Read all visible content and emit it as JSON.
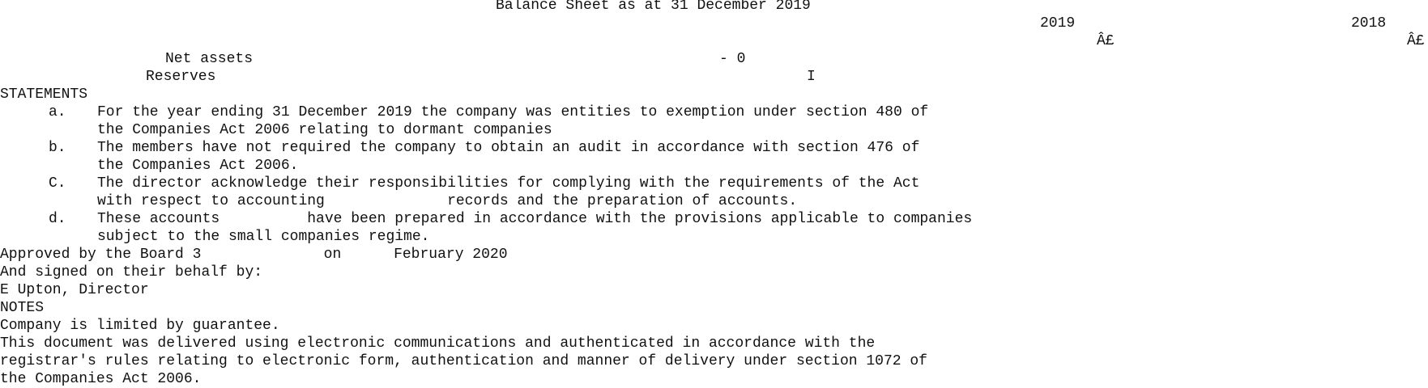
{
  "title": "Balance Sheet as at 31 December 2019",
  "columns": {
    "year_current": "2019",
    "year_prior": "2018",
    "currency_current": "Â£",
    "currency_prior": "Â£"
  },
  "rows": {
    "net_assets_label": "Net assets",
    "net_assets_value": "- 0",
    "reserves_label": "Reserves",
    "reserves_value": "I"
  },
  "statements": {
    "heading": "STATEMENTS",
    "items": [
      {
        "marker": "a.",
        "lines": [
          "For the year ending 31 December 2019 the company was entities to exemption under section 480 of",
          "the Companies Act 2006 relating to dormant companies"
        ]
      },
      {
        "marker": "b.",
        "lines": [
          "The members have not required the company to obtain an audit in accordance with section 476 of",
          "the Companies Act 2006."
        ]
      },
      {
        "marker": "C.",
        "lines": [
          "The director acknowledge their responsibilities for complying with the requirements of the Act",
          "with respect to accounting              records and the preparation of accounts."
        ]
      },
      {
        "marker": "d.",
        "lines": [
          "These accounts          have been prepared in accordance with the provisions applicable to companies",
          "subject to the small companies regime."
        ]
      }
    ]
  },
  "approval": {
    "approved_line": "Approved by the Board 3              on      February 2020",
    "signed_line": "And signed on their behalf by:",
    "signatory": "E Upton, Director"
  },
  "notes": {
    "heading": "NOTES",
    "lines": [
      "Company is limited by guarantee.",
      "This document was delivered using electronic communications and authenticated in accordance with the",
      "registrar's rules relating to electronic form, authentication and manner of delivery under section 1072 of",
      "the Companies Act 2006."
    ]
  }
}
